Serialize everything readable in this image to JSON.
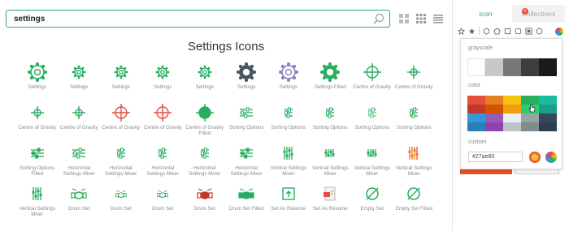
{
  "search": {
    "query": "settings"
  },
  "page": {
    "title": "Settings Icons"
  },
  "panel": {
    "tab_icon": "Icon",
    "tab_collections": "Collections",
    "collections_badge": "5",
    "sec_grayscale": "grayscale",
    "sec_color": "color",
    "sec_custom": "custom",
    "custom_hex": "#27ae60"
  },
  "colors": {
    "accent": "#27ae60",
    "grayscale": [
      "#ffffff",
      "#c8c8c8",
      "#777777",
      "#3d3d3d",
      "#1a1a1a"
    ],
    "palette": [
      [
        "#e74c3c",
        "#e67e22",
        "#f1c40f",
        "#27ae60",
        "#1abc9c"
      ],
      [
        "#c0392b",
        "#d35400",
        "#f39c12",
        "#2ecc71",
        "#16a085"
      ],
      [
        "#3498db",
        "#9b59b6",
        "#ecf0f1",
        "#95a5a6",
        "#34495e"
      ],
      [
        "#2980b9",
        "#8e44ad",
        "#bdc3c7",
        "#7f8c8d",
        "#2c3e50"
      ]
    ]
  },
  "icons": [
    {
      "label": "Settings",
      "icon": "gear-outline-icon",
      "color": "#27ae60"
    },
    {
      "label": "Settings",
      "icon": "gear-small-icon",
      "color": "#27ae60"
    },
    {
      "label": "Settings",
      "icon": "gear-small-icon",
      "color": "#27ae60"
    },
    {
      "label": "Settings",
      "icon": "gear-small-icon",
      "color": "#27ae60"
    },
    {
      "label": "Settings",
      "icon": "gear-small-icon",
      "color": "#27ae60"
    },
    {
      "label": "Settings",
      "icon": "gear-filled-icon",
      "color": "#4a5560"
    },
    {
      "label": "Settings",
      "icon": "gear-outline-icon",
      "color": "#8e7cc3"
    },
    {
      "label": "Settings Filled",
      "icon": "gear-filled-icon",
      "color": "#27ae60"
    },
    {
      "label": "Centre of Gravity",
      "icon": "crosshair-icon",
      "color": "#27ae60"
    },
    {
      "label": "Centre of Gravity",
      "icon": "crosshair-small-icon",
      "color": "#27ae60"
    },
    {
      "label": "Centre of Gravity",
      "icon": "crosshair-small-icon",
      "color": "#27ae60"
    },
    {
      "label": "Centre of Gravity",
      "icon": "crosshair-small-icon",
      "color": "#27ae60"
    },
    {
      "label": "Centre of Gravity",
      "icon": "crosshair-icon",
      "color": "#e74c3c"
    },
    {
      "label": "Centre of Gravity",
      "icon": "crosshair-dots-icon",
      "color": "#e74c3c"
    },
    {
      "label": "Centre of Gravity Filled",
      "icon": "crosshair-filled-icon",
      "color": "#27ae60"
    },
    {
      "label": "Sorting Options",
      "icon": "sliders-icon",
      "color": "#27ae60"
    },
    {
      "label": "Sorting Options",
      "icon": "sliders-small-icon",
      "color": "#27ae60"
    },
    {
      "label": "Sorting Options",
      "icon": "sliders-small-icon",
      "color": "#27ae60"
    },
    {
      "label": "Sorting Options",
      "icon": "sliders-small-icon",
      "color": "#5fc48a"
    },
    {
      "label": "Sorting Options",
      "icon": "sliders-small-icon",
      "color": "#27ae60"
    },
    {
      "label": "Sorting Options Filled",
      "icon": "sliders-filled-icon",
      "color": "#27ae60"
    },
    {
      "label": "Horizontal Settings Mixer",
      "icon": "sliders-icon",
      "color": "#27ae60"
    },
    {
      "label": "Horizontal Settings Mixer",
      "icon": "sliders-small-icon",
      "color": "#27ae60"
    },
    {
      "label": "Horizontal Settings Mixer",
      "icon": "sliders-small-icon",
      "color": "#27ae60"
    },
    {
      "label": "Horizontal Settings Mixer",
      "icon": "sliders-small-icon",
      "color": "#27ae60"
    },
    {
      "label": "Horizontal Settings Mixer",
      "icon": "sliders-filled-icon",
      "color": "#27ae60"
    },
    {
      "label": "Vertical Settings Mixer",
      "icon": "vmixer-icon",
      "color": "#27ae60"
    },
    {
      "label": "Vertical Settings Mixer",
      "icon": "vmixer-small-icon",
      "color": "#27ae60"
    },
    {
      "label": "Vertical Settings Mixer",
      "icon": "vmixer-small-icon",
      "color": "#27ae60"
    },
    {
      "label": "Vertical Settings Mixer",
      "icon": "vmixer-color-icon",
      "color": "#e67e22"
    },
    {
      "label": "Vertical Settings Mixer",
      "icon": "vmixer-icon",
      "color": "#27ae60"
    },
    {
      "label": "Drum Set",
      "icon": "drum-icon",
      "color": "#27ae60"
    },
    {
      "label": "Drum Set",
      "icon": "drum-small-icon",
      "color": "#27ae60"
    },
    {
      "label": "Drum Set",
      "icon": "drum-small-icon",
      "color": "#27ae60"
    },
    {
      "label": "Drum Set",
      "icon": "drum-color-icon",
      "color": "#c0392b"
    },
    {
      "label": "Drum Set Filled",
      "icon": "drum-filled-icon",
      "color": "#27ae60"
    },
    {
      "label": "Set As Resume",
      "icon": "resume-icon",
      "color": "#27ae60"
    },
    {
      "label": "Set As Resume",
      "icon": "resume-color-icon",
      "color": "#e74c3c"
    },
    {
      "label": "Empty Set",
      "icon": "empty-set-icon",
      "color": "#27ae60"
    },
    {
      "label": "Empty Set Filled",
      "icon": "empty-set-icon",
      "color": "#27ae60"
    }
  ]
}
